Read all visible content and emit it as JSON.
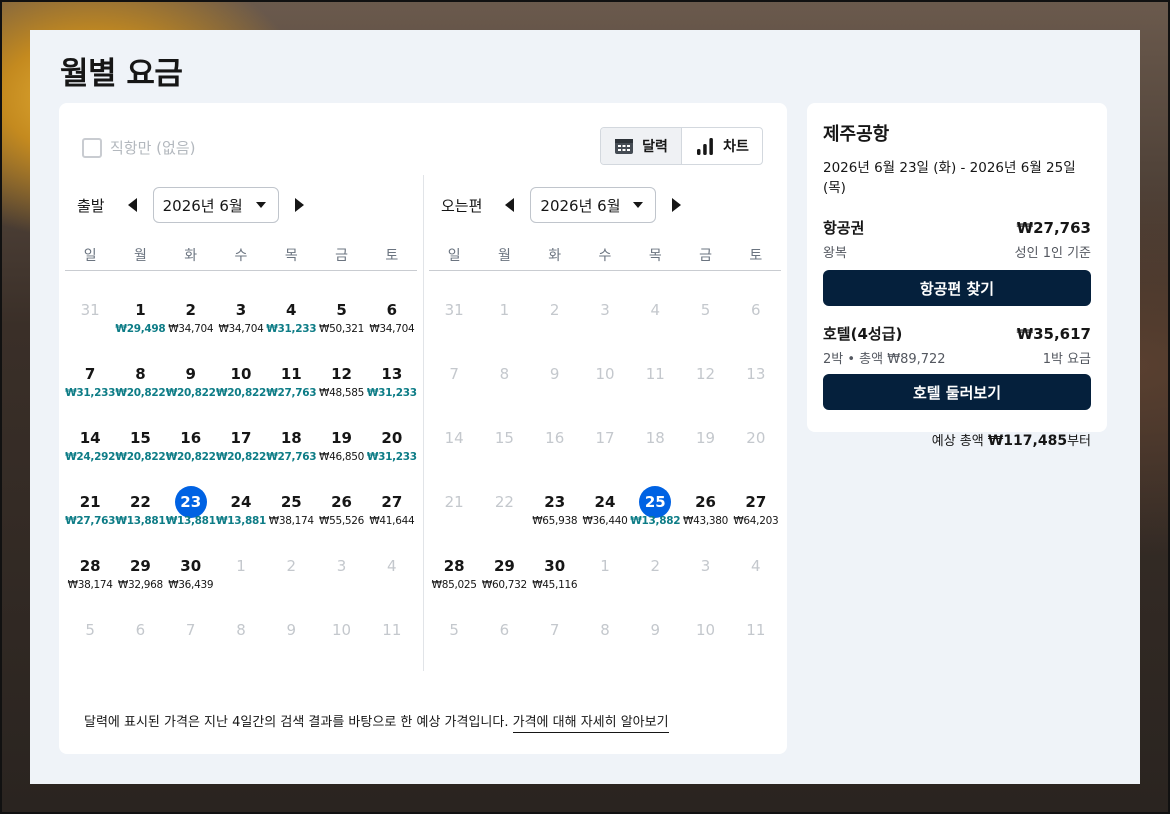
{
  "title": "월별 요금",
  "direct_only": "직항만 (없음)",
  "view_toggle": {
    "calendar": "달력",
    "chart": "차트"
  },
  "departure": {
    "label": "출발",
    "month": "2026년 6월",
    "dow": [
      "일",
      "월",
      "화",
      "수",
      "목",
      "금",
      "토"
    ],
    "weeks": [
      [
        {
          "d": "31",
          "f": 1
        },
        {
          "d": "1",
          "p": "₩29,498",
          "l": 1
        },
        {
          "d": "2",
          "p": "₩34,704"
        },
        {
          "d": "3",
          "p": "₩34,704"
        },
        {
          "d": "4",
          "p": "₩31,233",
          "l": 1
        },
        {
          "d": "5",
          "p": "₩50,321"
        },
        {
          "d": "6",
          "p": "₩34,704"
        }
      ],
      [
        {
          "d": "7",
          "p": "₩31,233",
          "l": 1
        },
        {
          "d": "8",
          "p": "₩20,822",
          "l": 1
        },
        {
          "d": "9",
          "p": "₩20,822",
          "l": 1
        },
        {
          "d": "10",
          "p": "₩20,822",
          "l": 1
        },
        {
          "d": "11",
          "p": "₩27,763",
          "l": 1
        },
        {
          "d": "12",
          "p": "₩48,585"
        },
        {
          "d": "13",
          "p": "₩31,233",
          "l": 1
        }
      ],
      [
        {
          "d": "14",
          "p": "₩24,292",
          "l": 1
        },
        {
          "d": "15",
          "p": "₩20,822",
          "l": 1
        },
        {
          "d": "16",
          "p": "₩20,822",
          "l": 1
        },
        {
          "d": "17",
          "p": "₩20,822",
          "l": 1
        },
        {
          "d": "18",
          "p": "₩27,763",
          "l": 1
        },
        {
          "d": "19",
          "p": "₩46,850"
        },
        {
          "d": "20",
          "p": "₩31,233",
          "l": 1
        }
      ],
      [
        {
          "d": "21",
          "p": "₩27,763",
          "l": 1
        },
        {
          "d": "22",
          "p": "₩13,881",
          "l": 1
        },
        {
          "d": "23",
          "p": "₩13,881",
          "l": 1,
          "s": 1
        },
        {
          "d": "24",
          "p": "₩13,881",
          "l": 1
        },
        {
          "d": "25",
          "p": "₩38,174"
        },
        {
          "d": "26",
          "p": "₩55,526"
        },
        {
          "d": "27",
          "p": "₩41,644"
        }
      ],
      [
        {
          "d": "28",
          "p": "₩38,174"
        },
        {
          "d": "29",
          "p": "₩32,968"
        },
        {
          "d": "30",
          "p": "₩36,439"
        },
        {
          "d": "1",
          "f": 1
        },
        {
          "d": "2",
          "f": 1
        },
        {
          "d": "3",
          "f": 1
        },
        {
          "d": "4",
          "f": 1
        }
      ],
      [
        {
          "d": "5",
          "f": 1
        },
        {
          "d": "6",
          "f": 1
        },
        {
          "d": "7",
          "f": 1
        },
        {
          "d": "8",
          "f": 1
        },
        {
          "d": "9",
          "f": 1
        },
        {
          "d": "10",
          "f": 1
        },
        {
          "d": "11",
          "f": 1
        }
      ]
    ]
  },
  "return": {
    "label": "오는편",
    "month": "2026년 6월",
    "dow": [
      "일",
      "월",
      "화",
      "수",
      "목",
      "금",
      "토"
    ],
    "weeks": [
      [
        {
          "d": "31",
          "f": 1
        },
        {
          "d": "1",
          "f": 1
        },
        {
          "d": "2",
          "f": 1
        },
        {
          "d": "3",
          "f": 1
        },
        {
          "d": "4",
          "f": 1
        },
        {
          "d": "5",
          "f": 1
        },
        {
          "d": "6",
          "f": 1
        }
      ],
      [
        {
          "d": "7",
          "f": 1
        },
        {
          "d": "8",
          "f": 1
        },
        {
          "d": "9",
          "f": 1
        },
        {
          "d": "10",
          "f": 1
        },
        {
          "d": "11",
          "f": 1
        },
        {
          "d": "12",
          "f": 1
        },
        {
          "d": "13",
          "f": 1
        }
      ],
      [
        {
          "d": "14",
          "f": 1
        },
        {
          "d": "15",
          "f": 1
        },
        {
          "d": "16",
          "f": 1
        },
        {
          "d": "17",
          "f": 1
        },
        {
          "d": "18",
          "f": 1
        },
        {
          "d": "19",
          "f": 1
        },
        {
          "d": "20",
          "f": 1
        }
      ],
      [
        {
          "d": "21",
          "f": 1
        },
        {
          "d": "22",
          "f": 1
        },
        {
          "d": "23",
          "p": "₩65,938"
        },
        {
          "d": "24",
          "p": "₩36,440"
        },
        {
          "d": "25",
          "p": "₩13,882",
          "l": 1,
          "s": 1
        },
        {
          "d": "26",
          "p": "₩43,380"
        },
        {
          "d": "27",
          "p": "₩64,203"
        }
      ],
      [
        {
          "d": "28",
          "p": "₩85,025"
        },
        {
          "d": "29",
          "p": "₩60,732"
        },
        {
          "d": "30",
          "p": "₩45,116"
        },
        {
          "d": "1",
          "f": 1
        },
        {
          "d": "2",
          "f": 1
        },
        {
          "d": "3",
          "f": 1
        },
        {
          "d": "4",
          "f": 1
        }
      ],
      [
        {
          "d": "5",
          "f": 1
        },
        {
          "d": "6",
          "f": 1
        },
        {
          "d": "7",
          "f": 1
        },
        {
          "d": "8",
          "f": 1
        },
        {
          "d": "9",
          "f": 1
        },
        {
          "d": "10",
          "f": 1
        },
        {
          "d": "11",
          "f": 1
        }
      ]
    ]
  },
  "footnote": {
    "text": "달력에 표시된 가격은 지난 4일간의 검색 결과를 바탕으로 한 예상 가격입니다.",
    "link": "가격에 대해 자세히 알아보기"
  },
  "summary": {
    "destination": "제주공항",
    "dates": "2026년 6월 23일 (화) - 2026년 6월 25일 (목)",
    "flight_label": "항공권",
    "flight_price": "₩27,763",
    "flight_type": "왕복",
    "flight_basis": "성인 1인 기준",
    "flight_button": "항공편 찾기",
    "hotel_label": "호텔(4성급)",
    "hotel_price": "₩35,617",
    "hotel_detail": "2박 • 총액 ₩89,722",
    "hotel_basis": "1박 요금",
    "hotel_button": "호텔 둘러보기",
    "total_prefix": "예상 총액",
    "total_amount": "₩117,485",
    "total_suffix": "부터"
  },
  "colors": {
    "accent": "#0062e3",
    "low_price": "#0d7c86",
    "button": "#05203c"
  }
}
